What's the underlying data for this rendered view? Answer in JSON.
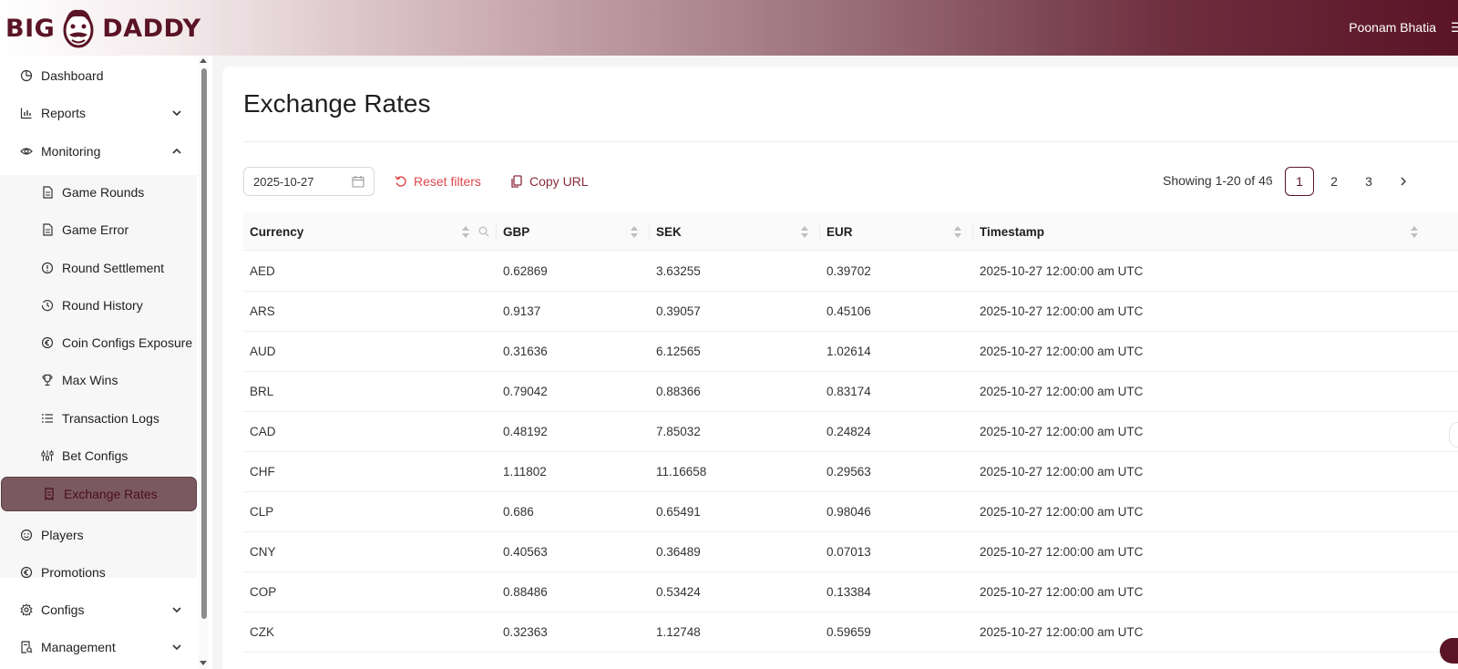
{
  "header": {
    "logo_left": "BIG",
    "logo_right": "DADDY",
    "user_name": "Poonam Bhatia",
    "brand_color": "#5a1426"
  },
  "sidebar": {
    "items": [
      {
        "label": "Dashboard",
        "icon": "pie-chart-icon"
      },
      {
        "label": "Reports",
        "icon": "bar-chart-icon",
        "expandable": true,
        "expanded": false
      },
      {
        "label": "Monitoring",
        "icon": "eye-icon",
        "expandable": true,
        "expanded": true
      },
      {
        "label": "Game Rounds",
        "icon": "file-icon",
        "sub": true
      },
      {
        "label": "Game Error",
        "icon": "file-icon",
        "sub": true
      },
      {
        "label": "Round Settlement",
        "icon": "exclamation-circle-icon",
        "sub": true
      },
      {
        "label": "Round History",
        "icon": "history-icon",
        "sub": true
      },
      {
        "label": "Coin Configs Exposure",
        "icon": "euro-circle-icon",
        "sub": true
      },
      {
        "label": "Max Wins",
        "icon": "trophy-icon",
        "sub": true
      },
      {
        "label": "Transaction Logs",
        "icon": "list-icon",
        "sub": true
      },
      {
        "label": "Bet Configs",
        "icon": "sliders-icon",
        "sub": true
      },
      {
        "label": "Exchange Rates",
        "icon": "receipt-icon",
        "sub": true,
        "active": true
      },
      {
        "label": "Players",
        "icon": "smile-icon"
      },
      {
        "label": "Promotions",
        "icon": "euro-circle-icon"
      },
      {
        "label": "Configs",
        "icon": "gear-icon",
        "expandable": true,
        "expanded": false
      },
      {
        "label": "Management",
        "icon": "audit-icon",
        "expandable": true,
        "expanded": false
      }
    ]
  },
  "main": {
    "title": "Exchange Rates",
    "date_filter": "2025-10-27",
    "reset_label": "Reset filters",
    "copy_label": "Copy URL",
    "showing": "Showing 1-20 of 46",
    "pages": [
      "1",
      "2",
      "3"
    ],
    "current_page": "1"
  },
  "table": {
    "columns": [
      "Currency",
      "GBP",
      "SEK",
      "EUR",
      "Timestamp"
    ],
    "rows": [
      [
        "AED",
        "0.62869",
        "3.63255",
        "0.39702",
        "2025-10-27 12:00:00 am UTC"
      ],
      [
        "ARS",
        "0.9137",
        "0.39057",
        "0.45106",
        "2025-10-27 12:00:00 am UTC"
      ],
      [
        "AUD",
        "0.31636",
        "6.12565",
        "1.02614",
        "2025-10-27 12:00:00 am UTC"
      ],
      [
        "BRL",
        "0.79042",
        "0.88366",
        "0.83174",
        "2025-10-27 12:00:00 am UTC"
      ],
      [
        "CAD",
        "0.48192",
        "7.85032",
        "0.24824",
        "2025-10-27 12:00:00 am UTC"
      ],
      [
        "CHF",
        "1.11802",
        "11.16658",
        "0.29563",
        "2025-10-27 12:00:00 am UTC"
      ],
      [
        "CLP",
        "0.686",
        "0.65491",
        "0.98046",
        "2025-10-27 12:00:00 am UTC"
      ],
      [
        "CNY",
        "0.40563",
        "0.36489",
        "0.07013",
        "2025-10-27 12:00:00 am UTC"
      ],
      [
        "COP",
        "0.88486",
        "0.53424",
        "0.13384",
        "2025-10-27 12:00:00 am UTC"
      ],
      [
        "CZK",
        "0.32363",
        "1.12748",
        "0.59659",
        "2025-10-27 12:00:00 am UTC"
      ]
    ]
  }
}
